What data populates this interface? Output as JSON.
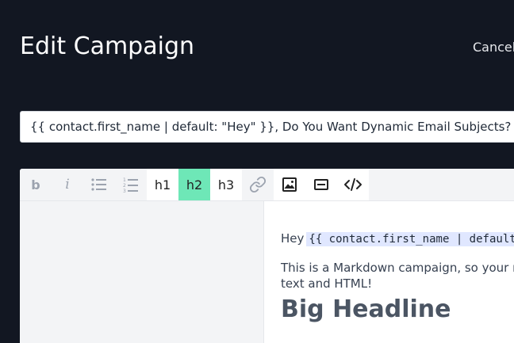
{
  "page": {
    "title": "Edit Campaign",
    "cancel_label": "Cancel"
  },
  "subject": {
    "value": "{{ contact.first_name | default: \"Hey\" }}, Do You Want Dynamic Email Subjects?"
  },
  "toolbar": {
    "bold_label": "b",
    "italic_label": "i",
    "h1_label": "h1",
    "h2_label": "h2",
    "h3_label": "h3",
    "active_heading": "h2",
    "icons": [
      "bold-icon",
      "italic-icon",
      "bullet-list-icon",
      "numbered-list-icon",
      "link-icon",
      "image-icon",
      "horizontal-rule-icon",
      "code-icon"
    ],
    "active_color": "#6ee7b7"
  },
  "preview": {
    "greeting_prefix": "Hey",
    "greeting_code": "{{ contact.first_name | default: \"Hey\" }}",
    "paragraph_line1": "This is a Markdown campaign, so your markdown will be rendered as",
    "paragraph_line2": "text and HTML!",
    "heading": "Big Headline"
  }
}
